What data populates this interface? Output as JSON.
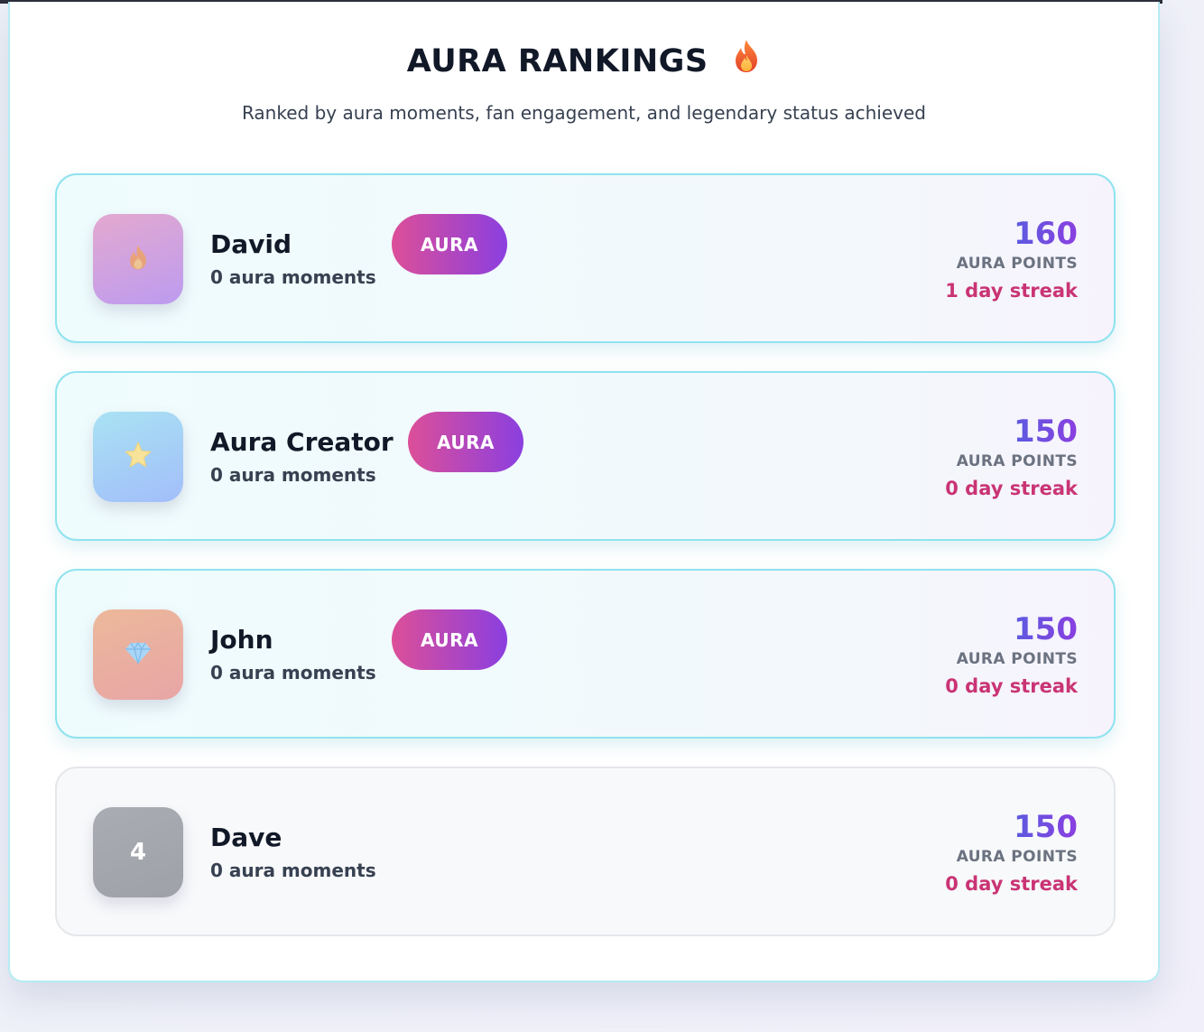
{
  "header": {
    "title": "AURA RANKINGS",
    "title_icon": "fire-icon",
    "subtitle": "Ranked by aura moments, fan engagement, and legendary status achieved"
  },
  "rankings": [
    {
      "name": "David",
      "moments": "0 aura moments",
      "badge": "AURA",
      "points": "160",
      "points_label": "AURA POINTS",
      "streak": "1 day streak",
      "avatar_icon": "fire-icon",
      "avatar_colors": [
        "#e3a9cf",
        "#bd9bf0"
      ]
    },
    {
      "name": "Aura Creator",
      "moments": "0 aura moments",
      "badge": "AURA",
      "points": "150",
      "points_label": "AURA POINTS",
      "streak": "0 day streak",
      "avatar_icon": "star-icon",
      "avatar_colors": [
        "#a9e2f3",
        "#a2befa"
      ]
    },
    {
      "name": "John",
      "moments": "0 aura moments",
      "badge": "AURA",
      "points": "150",
      "points_label": "AURA POINTS",
      "streak": "0 day streak",
      "avatar_icon": "diamond-icon",
      "avatar_colors": [
        "#ecb89a",
        "#e8a5a6"
      ]
    },
    {
      "name": "Dave",
      "moments": "0 aura moments",
      "rank": "4",
      "points": "150",
      "points_label": "AURA POINTS",
      "streak": "0 day streak",
      "avatar_colors": [
        "#a9acb2",
        "#9ea2a8"
      ]
    }
  ],
  "colors": {
    "accent_pink": "#dc4f98",
    "accent_purple": "#8b3fe0",
    "points_blue": "#5b5be0",
    "streak": "#c93474",
    "card_border": "#8fe3ee"
  }
}
